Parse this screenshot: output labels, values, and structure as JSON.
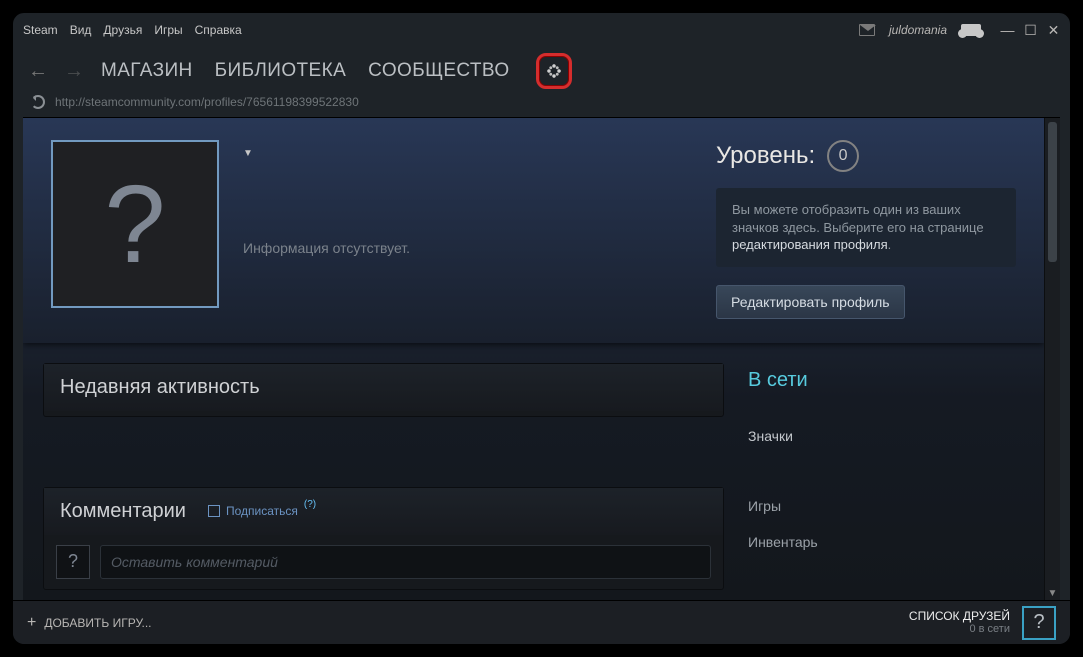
{
  "menubar": {
    "items": [
      "Steam",
      "Вид",
      "Друзья",
      "Игры",
      "Справка"
    ],
    "username": "juldomania"
  },
  "nav": {
    "tabs": [
      "МАГАЗИН",
      "БИБЛИОТЕКА",
      "СООБЩЕСТВО"
    ]
  },
  "url": "http://steamcommunity.com/profiles/76561198399522830",
  "profile": {
    "dropdown_icon": "▼",
    "no_info": "Информация отсутствует.",
    "level_label": "Уровень:",
    "level_value": "0",
    "badge_hint_prefix": "Вы можете отобразить один из ваших значков здесь. Выберите его на странице ",
    "badge_hint_link": "редактирования профиля",
    "badge_hint_suffix": ".",
    "edit_button": "Редактировать профиль"
  },
  "recent_activity_title": "Недавняя активность",
  "comments": {
    "title": "Комментарии",
    "subscribe": "Подписаться",
    "help_sup": "(?)",
    "placeholder": "Оставить комментарий"
  },
  "sidebar": {
    "online": "В сети",
    "links": [
      "Значки",
      "Игры",
      "Инвентарь"
    ]
  },
  "bottombar": {
    "add_game": "ДОБАВИТЬ ИГРУ...",
    "friends_title": "СПИСОК ДРУЗЕЙ",
    "friends_sub": "0 в сети"
  }
}
